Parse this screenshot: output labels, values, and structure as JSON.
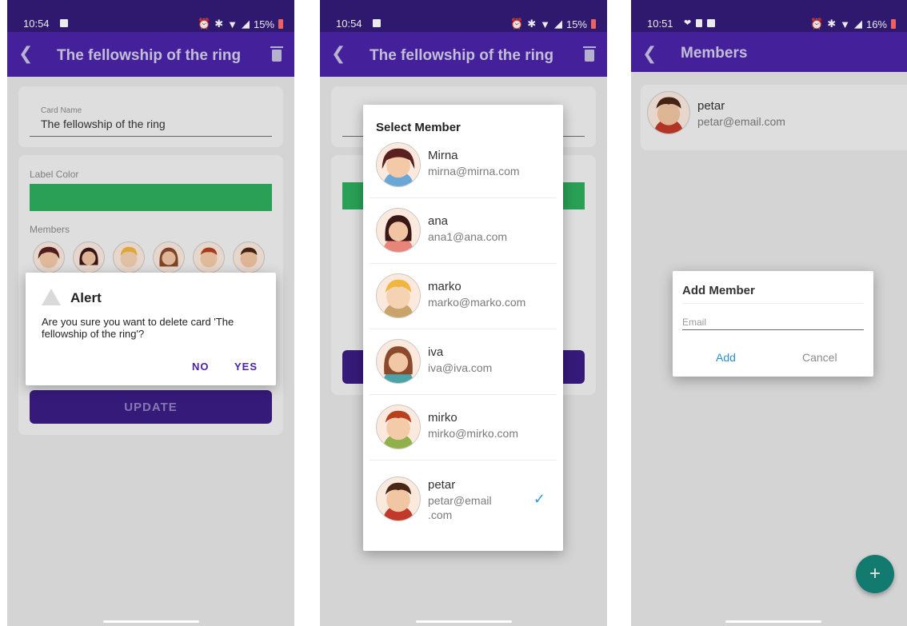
{
  "status_bar": [
    {
      "time": "10:54",
      "battery": "15%"
    },
    {
      "time": "10:54",
      "battery": "15%"
    },
    {
      "time": "10:51",
      "battery": "16%"
    }
  ],
  "screen1": {
    "title": "The fellowship of the ring",
    "card_name_label": "Card Name",
    "card_name_value": "The fellowship of the ring",
    "label_color_label": "Label Color",
    "label_color": "#2dae5e",
    "members_label": "Members",
    "update_label": "UPDATE",
    "alert": {
      "title": "Alert",
      "message": "Are you sure you want to delete card 'The fellowship of the ring'?",
      "no_label": "NO",
      "yes_label": "YES"
    }
  },
  "screen2": {
    "title": "The fellowship of the ring",
    "dialog_title": "Select Member",
    "members": [
      {
        "name": "Mirna",
        "email": "mirna@mirna.com",
        "selected": false
      },
      {
        "name": "ana",
        "email": "ana1@ana.com",
        "selected": false
      },
      {
        "name": "marko",
        "email": "marko@marko.com",
        "selected": false
      },
      {
        "name": "iva",
        "email": "iva@iva.com",
        "selected": false
      },
      {
        "name": "mirko",
        "email": "mirko@mirko.com",
        "selected": false
      },
      {
        "name": "petar",
        "email": "petar@email.com",
        "email_line1": "petar@email",
        "email_line2": ".com",
        "selected": true
      }
    ]
  },
  "screen3": {
    "title": "Members",
    "member": {
      "name": "petar",
      "email": "petar@email.com"
    },
    "dialog": {
      "title": "Add Member",
      "email_placeholder": "Email",
      "add_label": "Add",
      "cancel_label": "Cancel"
    },
    "fab_label": "+"
  },
  "colors": {
    "app_bar": "#4a23a8",
    "status_bar": "#321c78",
    "accent": "#4a23a8",
    "label_color": "#2dae5e",
    "fab": "#137a70",
    "check": "#2d9bd6"
  }
}
